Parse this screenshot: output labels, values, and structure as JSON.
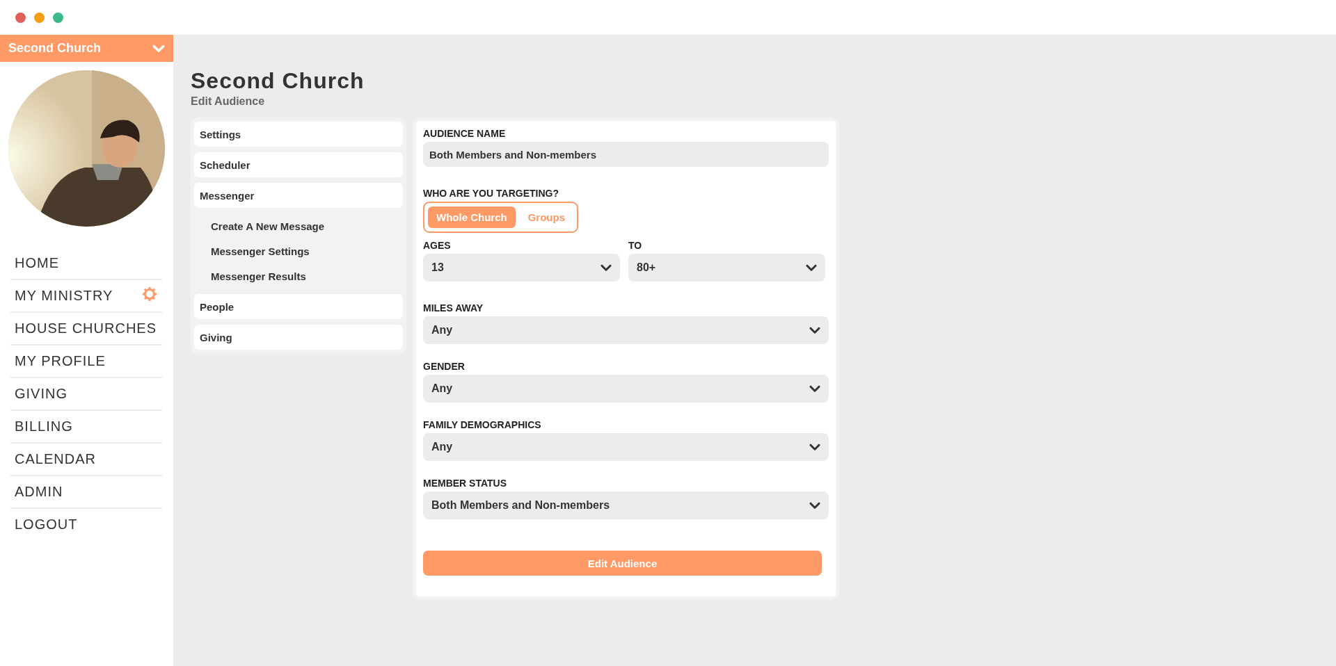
{
  "window": {
    "controls": [
      {
        "color": "#e0605a"
      },
      {
        "color": "#f59d14"
      },
      {
        "color": "#3cb88b"
      }
    ]
  },
  "sidebar": {
    "org_selector": "Second Church",
    "items": [
      {
        "label": "HOME",
        "settings_icon": false
      },
      {
        "label": "MY MINISTRY",
        "settings_icon": true
      },
      {
        "label": "HOUSE CHURCHES",
        "settings_icon": false
      },
      {
        "label": "MY PROFILE",
        "settings_icon": false
      },
      {
        "label": "GIVING",
        "settings_icon": false
      },
      {
        "label": "BILLING",
        "settings_icon": false
      },
      {
        "label": "CALENDAR",
        "settings_icon": false
      },
      {
        "label": "ADMIN",
        "settings_icon": false
      },
      {
        "label": "LOGOUT",
        "settings_icon": false
      }
    ]
  },
  "page": {
    "title": "Second Church",
    "subtitle": "Edit Audience"
  },
  "section_nav": [
    {
      "label": "Settings"
    },
    {
      "label": "Scheduler"
    },
    {
      "label": "Messenger",
      "children": [
        {
          "label": "Create A New Message"
        },
        {
          "label": "Messenger Settings"
        },
        {
          "label": "Messenger Results"
        }
      ]
    },
    {
      "label": "People"
    },
    {
      "label": "Giving"
    }
  ],
  "form": {
    "audience_name": {
      "label": "AUDIENCE NAME",
      "value": "Both Members and Non-members"
    },
    "targeting": {
      "label": "WHO ARE YOU TARGETING?",
      "options": [
        {
          "label": "Whole Church",
          "selected": true
        },
        {
          "label": "Groups",
          "selected": false
        }
      ]
    },
    "ages": {
      "label": "AGES",
      "value": "13"
    },
    "to": {
      "label": "TO",
      "value": "80+"
    },
    "selects": [
      {
        "label": "MILES AWAY",
        "value": "Any"
      },
      {
        "label": "GENDER",
        "value": "Any"
      },
      {
        "label": "FAMILY DEMOGRAPHICS",
        "value": "Any"
      },
      {
        "label": "MEMBER STATUS",
        "value": "Both Members and Non-members"
      }
    ],
    "submit": "Edit Audience"
  }
}
